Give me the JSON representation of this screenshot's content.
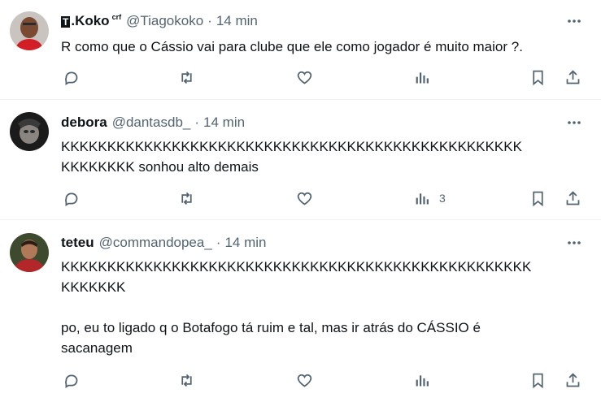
{
  "tweets": [
    {
      "name_logo": "T",
      "name": ".Koko",
      "badge": "crf",
      "handle": "@Tiagokoko",
      "dot": "·",
      "time": "14 min",
      "lines": [
        "R como que o Cássio vai para clube que ele como jogador é muito maior ?."
      ],
      "views": ""
    },
    {
      "name": "debora",
      "handle": "@dantasdb_",
      "dot": "·",
      "time": "14 min",
      "lines": [
        "KKKKKKKKKKKKKKKKKKKKKKKKKKKKKKKKKKKKKKKKKKKKKKKKKK",
        "KKKKKKKK sonhou alto demais"
      ],
      "views": "3"
    },
    {
      "name": "teteu",
      "handle": "@commandopea_",
      "dot": "·",
      "time": "14 min",
      "lines": [
        "KKKKKKKKKKKKKKKKKKKKKKKKKKKKKKKKKKKKKKKKKKKKKKKKKKK",
        "KKKKKKK"
      ],
      "lines2": [
        "po, eu to ligado q o Botafogo tá ruim e tal, mas ir atrás do CÁSSIO é",
        "sacanagem"
      ],
      "views": ""
    }
  ],
  "icons": [
    "reply-icon",
    "retweet-icon",
    "like-icon",
    "views-icon",
    "bookmark-icon",
    "share-icon",
    "more-icon"
  ],
  "colors": {
    "text": "#0f1419",
    "muted": "#536471",
    "divider": "#eff3f4"
  }
}
